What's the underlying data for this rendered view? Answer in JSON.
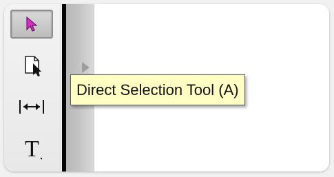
{
  "toolbar": {
    "tools": [
      {
        "name": "selection-tool",
        "icon": "pink-arrow-pointer-icon",
        "selected": true
      },
      {
        "name": "direct-selection-tool",
        "icon": "page-with-arrow-icon",
        "selected": false
      },
      {
        "name": "gap-tool",
        "icon": "horizontal-gap-arrows-icon",
        "selected": false
      },
      {
        "name": "type-tool",
        "icon": "text-t-icon",
        "selected": false
      }
    ],
    "type_glyph": "T"
  },
  "tooltip": {
    "text": "Direct Selection Tool (A)"
  },
  "colors": {
    "tooltip_background": "#ffffc4",
    "selected_icon": "#d62dc4",
    "dark_separator": "#050505"
  }
}
